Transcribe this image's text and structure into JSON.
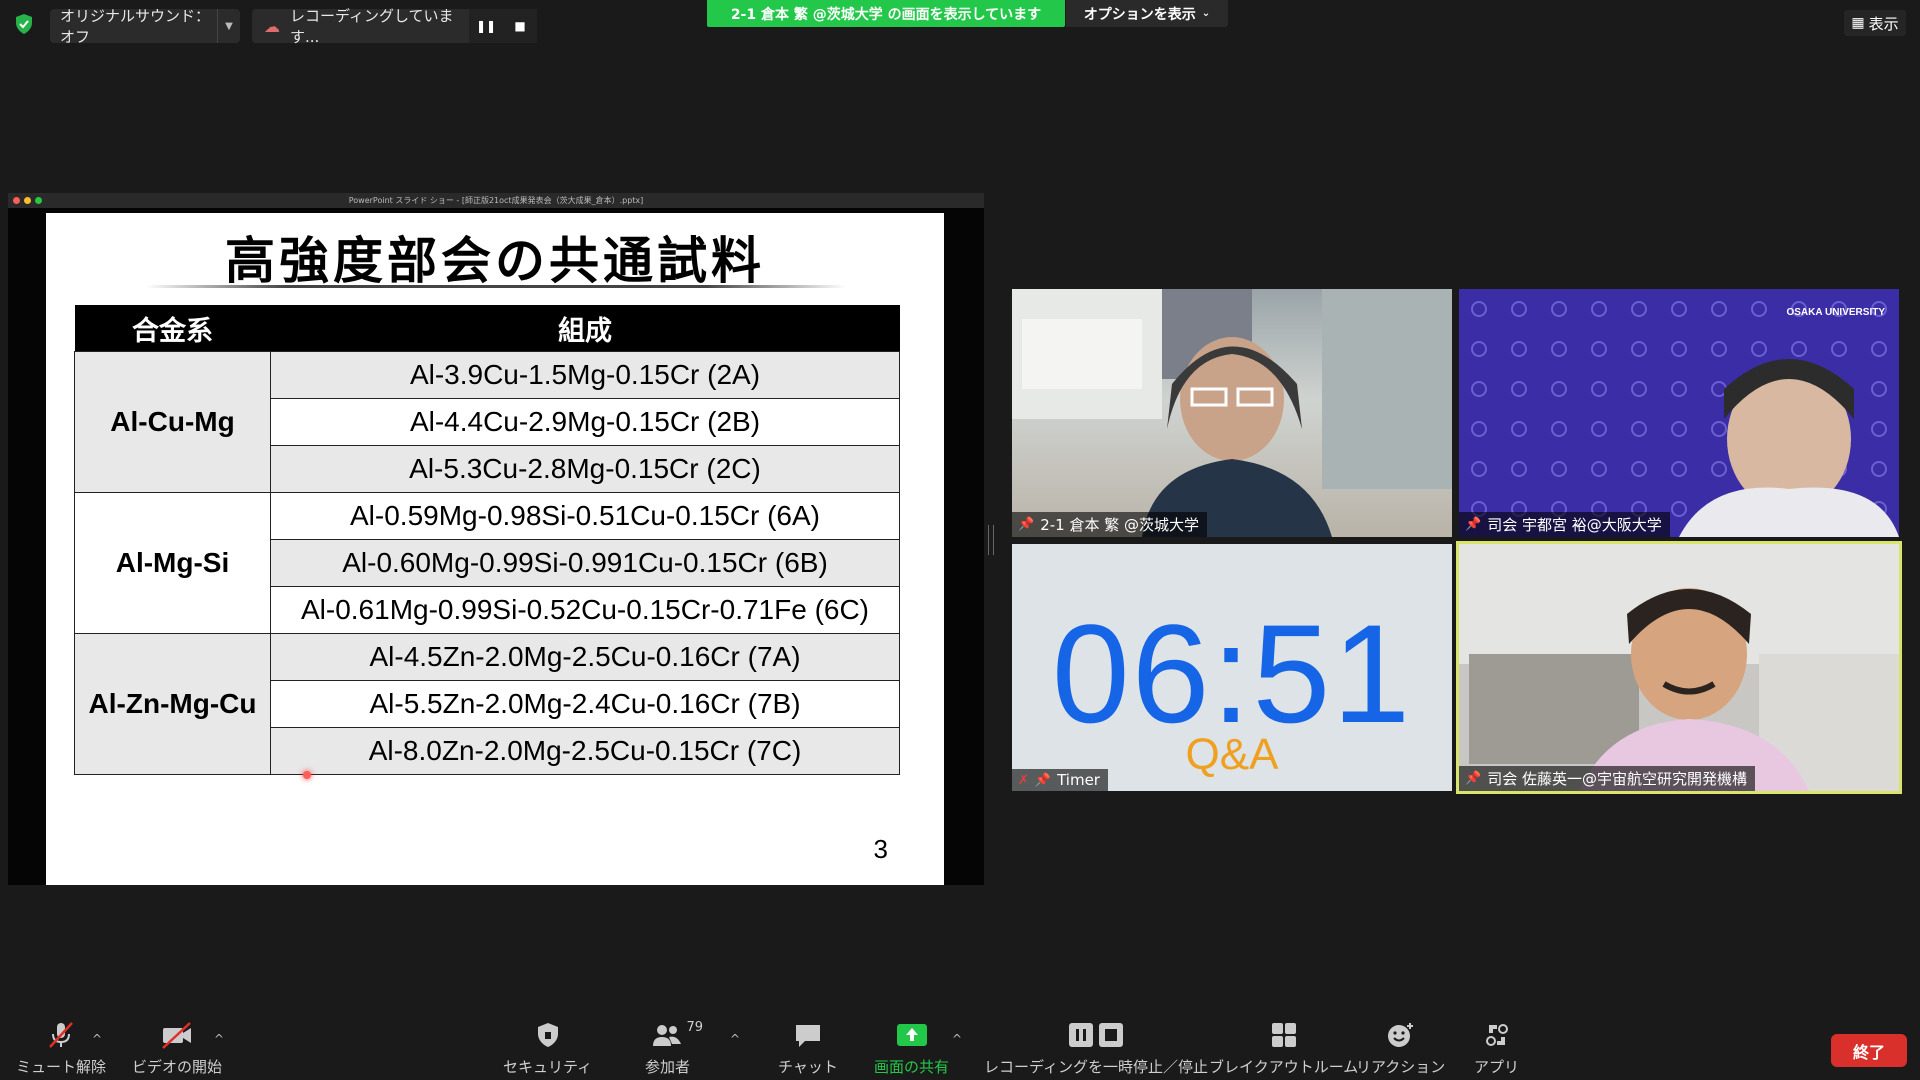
{
  "top_bar": {
    "audio_label": "オリジナルサウンド：オフ",
    "recording_label": "レコーディングしています...",
    "share_banner": "2-1 倉本 繁 @茨城大学 の画面を表示しています",
    "options_label": "オプションを表示",
    "view_label": "表示"
  },
  "share_window": {
    "title": "PowerPoint スライド ショー - [師正版21oct成果発表会（茨大成果_倉本）.pptx]"
  },
  "slide": {
    "title": "高強度部会の共通試料",
    "headers": [
      "合金系",
      "組成"
    ],
    "groups": [
      {
        "name": "Al-Cu-Mg",
        "rows": [
          "Al-3.9Cu-1.5Mg-0.15Cr (2A)",
          "Al-4.4Cu-2.9Mg-0.15Cr (2B)",
          "Al-5.3Cu-2.8Mg-0.15Cr (2C)"
        ]
      },
      {
        "name": "Al-Mg-Si",
        "rows": [
          "Al-0.59Mg-0.98Si-0.51Cu-0.15Cr (6A)",
          "Al-0.60Mg-0.99Si-0.991Cu-0.15Cr (6B)",
          "Al-0.61Mg-0.99Si-0.52Cu-0.15Cr-0.71Fe (6C)"
        ]
      },
      {
        "name": "Al-Zn-Mg-Cu",
        "rows": [
          "Al-4.5Zn-2.0Mg-2.5Cu-0.16Cr (7A)",
          "Al-5.5Zn-2.0Mg-2.4Cu-0.16Cr (7B)",
          "Al-8.0Zn-2.0Mg-2.5Cu-0.15Cr (7C)"
        ]
      }
    ],
    "page_number": "3"
  },
  "participants": [
    {
      "name": "2-1 倉本 繁 @茨城大学"
    },
    {
      "name": "司会 宇都宮 裕@大阪大学",
      "logo": "OSAKA UNIVERSITY"
    },
    {
      "name": "Timer",
      "timer": "06:51",
      "sub": "Q&A"
    },
    {
      "name": "司会 佐藤英一@宇宙航空研究開発機構"
    }
  ],
  "toolbar": {
    "mute": "ミュート解除",
    "video": "ビデオの開始",
    "security": "セキュリティ",
    "participants": "参加者",
    "participants_count": "79",
    "chat": "チャット",
    "share": "画面の共有",
    "recording": "レコーディングを一時停止／停止",
    "breakout": "ブレイクアウトルーム",
    "reactions": "リアクション",
    "apps": "アプリ",
    "end": "終了"
  },
  "colors": {
    "share_banner_green": "#23c84a",
    "timer_blue": "#1565e6",
    "timer_orange": "#f0a020",
    "end_red": "#d9302b",
    "active_speaker_border": "#d8e46a"
  }
}
